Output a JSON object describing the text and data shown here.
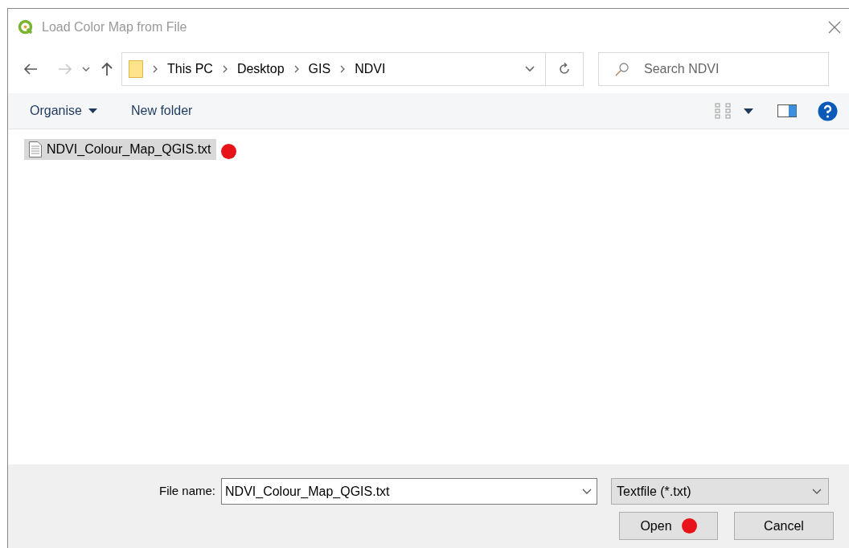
{
  "window": {
    "title": "Load Color Map from File"
  },
  "breadcrumb": [
    "This PC",
    "Desktop",
    "GIS",
    "NDVI"
  ],
  "search": {
    "placeholder": "Search NDVI"
  },
  "toolbar": {
    "organise": "Organise",
    "new_folder": "New folder"
  },
  "files": [
    {
      "name": "NDVI_Colour_Map_QGIS.txt",
      "selected": true
    }
  ],
  "file_name": {
    "label": "File name:",
    "value": "NDVI_Colour_Map_QGIS.txt"
  },
  "file_type": {
    "value": "Textfile (*.txt)"
  },
  "buttons": [
    {
      "label": "Open",
      "kind": "primary"
    },
    {
      "label": "Cancel",
      "kind": "cancel"
    }
  ]
}
